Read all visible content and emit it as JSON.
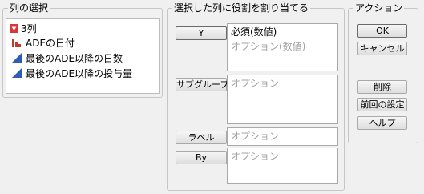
{
  "column_selection": {
    "title": "列の選択",
    "count_label": "3列",
    "columns": [
      {
        "label": "ADEの日付",
        "icon": "nominal-bar-icon"
      },
      {
        "label": "最後のADE以降の日数",
        "icon": "continuous-triangle-icon"
      },
      {
        "label": "最後のADE以降の投与量",
        "icon": "continuous-triangle-icon"
      }
    ]
  },
  "role_assignment": {
    "title": "選択した列に役割を割り当てる",
    "roles": [
      {
        "button": "Y",
        "required": "必須(数値)",
        "placeholder": "オプション(数値)"
      },
      {
        "button": "サブグループ",
        "placeholder": "オプション"
      },
      {
        "button": "ラベル",
        "placeholder": "オプション"
      },
      {
        "button": "By",
        "placeholder": "オプション"
      }
    ]
  },
  "actions": {
    "title": "アクション",
    "ok": "OK",
    "cancel": "キャンセル",
    "remove": "削除",
    "recall": "前回の設定",
    "help": "ヘルプ"
  },
  "colors": {
    "icon_red": "#c0392b",
    "icon_blue": "#2e5cb8",
    "placeholder_gray": "#a0a0a0"
  }
}
